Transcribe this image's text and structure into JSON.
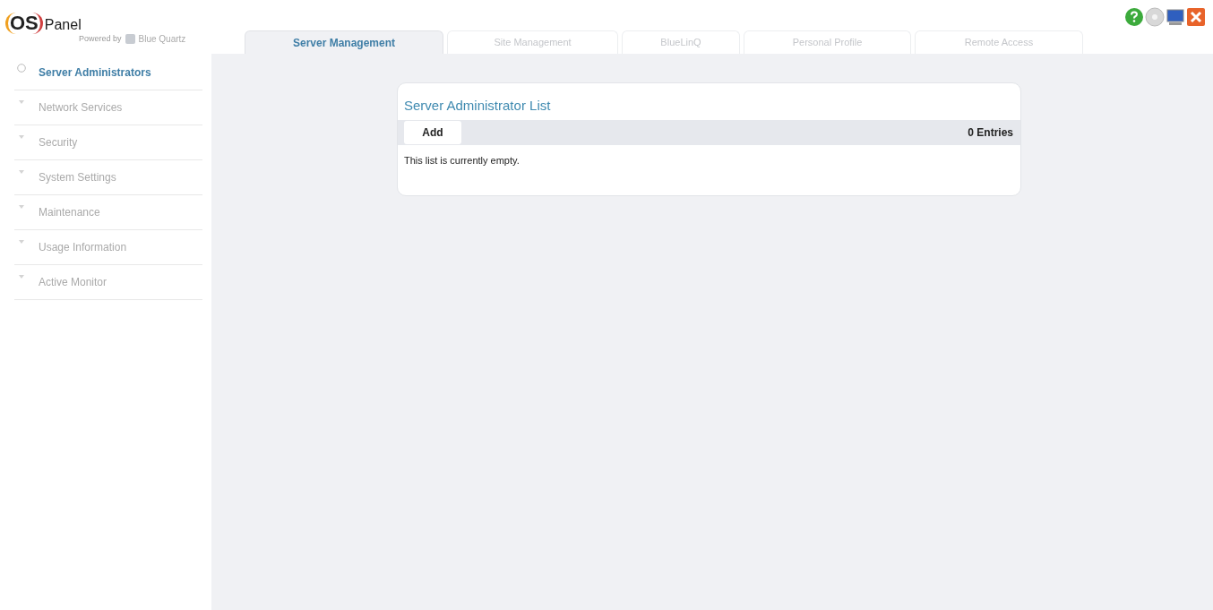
{
  "logo": {
    "mark": "OS",
    "name": "Panel",
    "powered_by": "Powered by",
    "brand": "Blue Quartz"
  },
  "tabs": [
    {
      "label": "Server Management",
      "selected": true
    },
    {
      "label": "Site Management",
      "selected": false
    },
    {
      "label": "BlueLinQ",
      "selected": false
    },
    {
      "label": "Personal Profile",
      "selected": false
    },
    {
      "label": "Remote Access",
      "selected": false
    }
  ],
  "sidebar": {
    "items": [
      {
        "label": "Server Administrators",
        "selected": true
      },
      {
        "label": "Network Services",
        "selected": false
      },
      {
        "label": "Security",
        "selected": false
      },
      {
        "label": "System Settings",
        "selected": false
      },
      {
        "label": "Maintenance",
        "selected": false
      },
      {
        "label": "Usage Information",
        "selected": false
      },
      {
        "label": "Active Monitor",
        "selected": false
      }
    ]
  },
  "card": {
    "title": "Server Administrator List",
    "add_button": "Add",
    "count": "0 Entries",
    "empty_message": "This list is currently empty."
  }
}
